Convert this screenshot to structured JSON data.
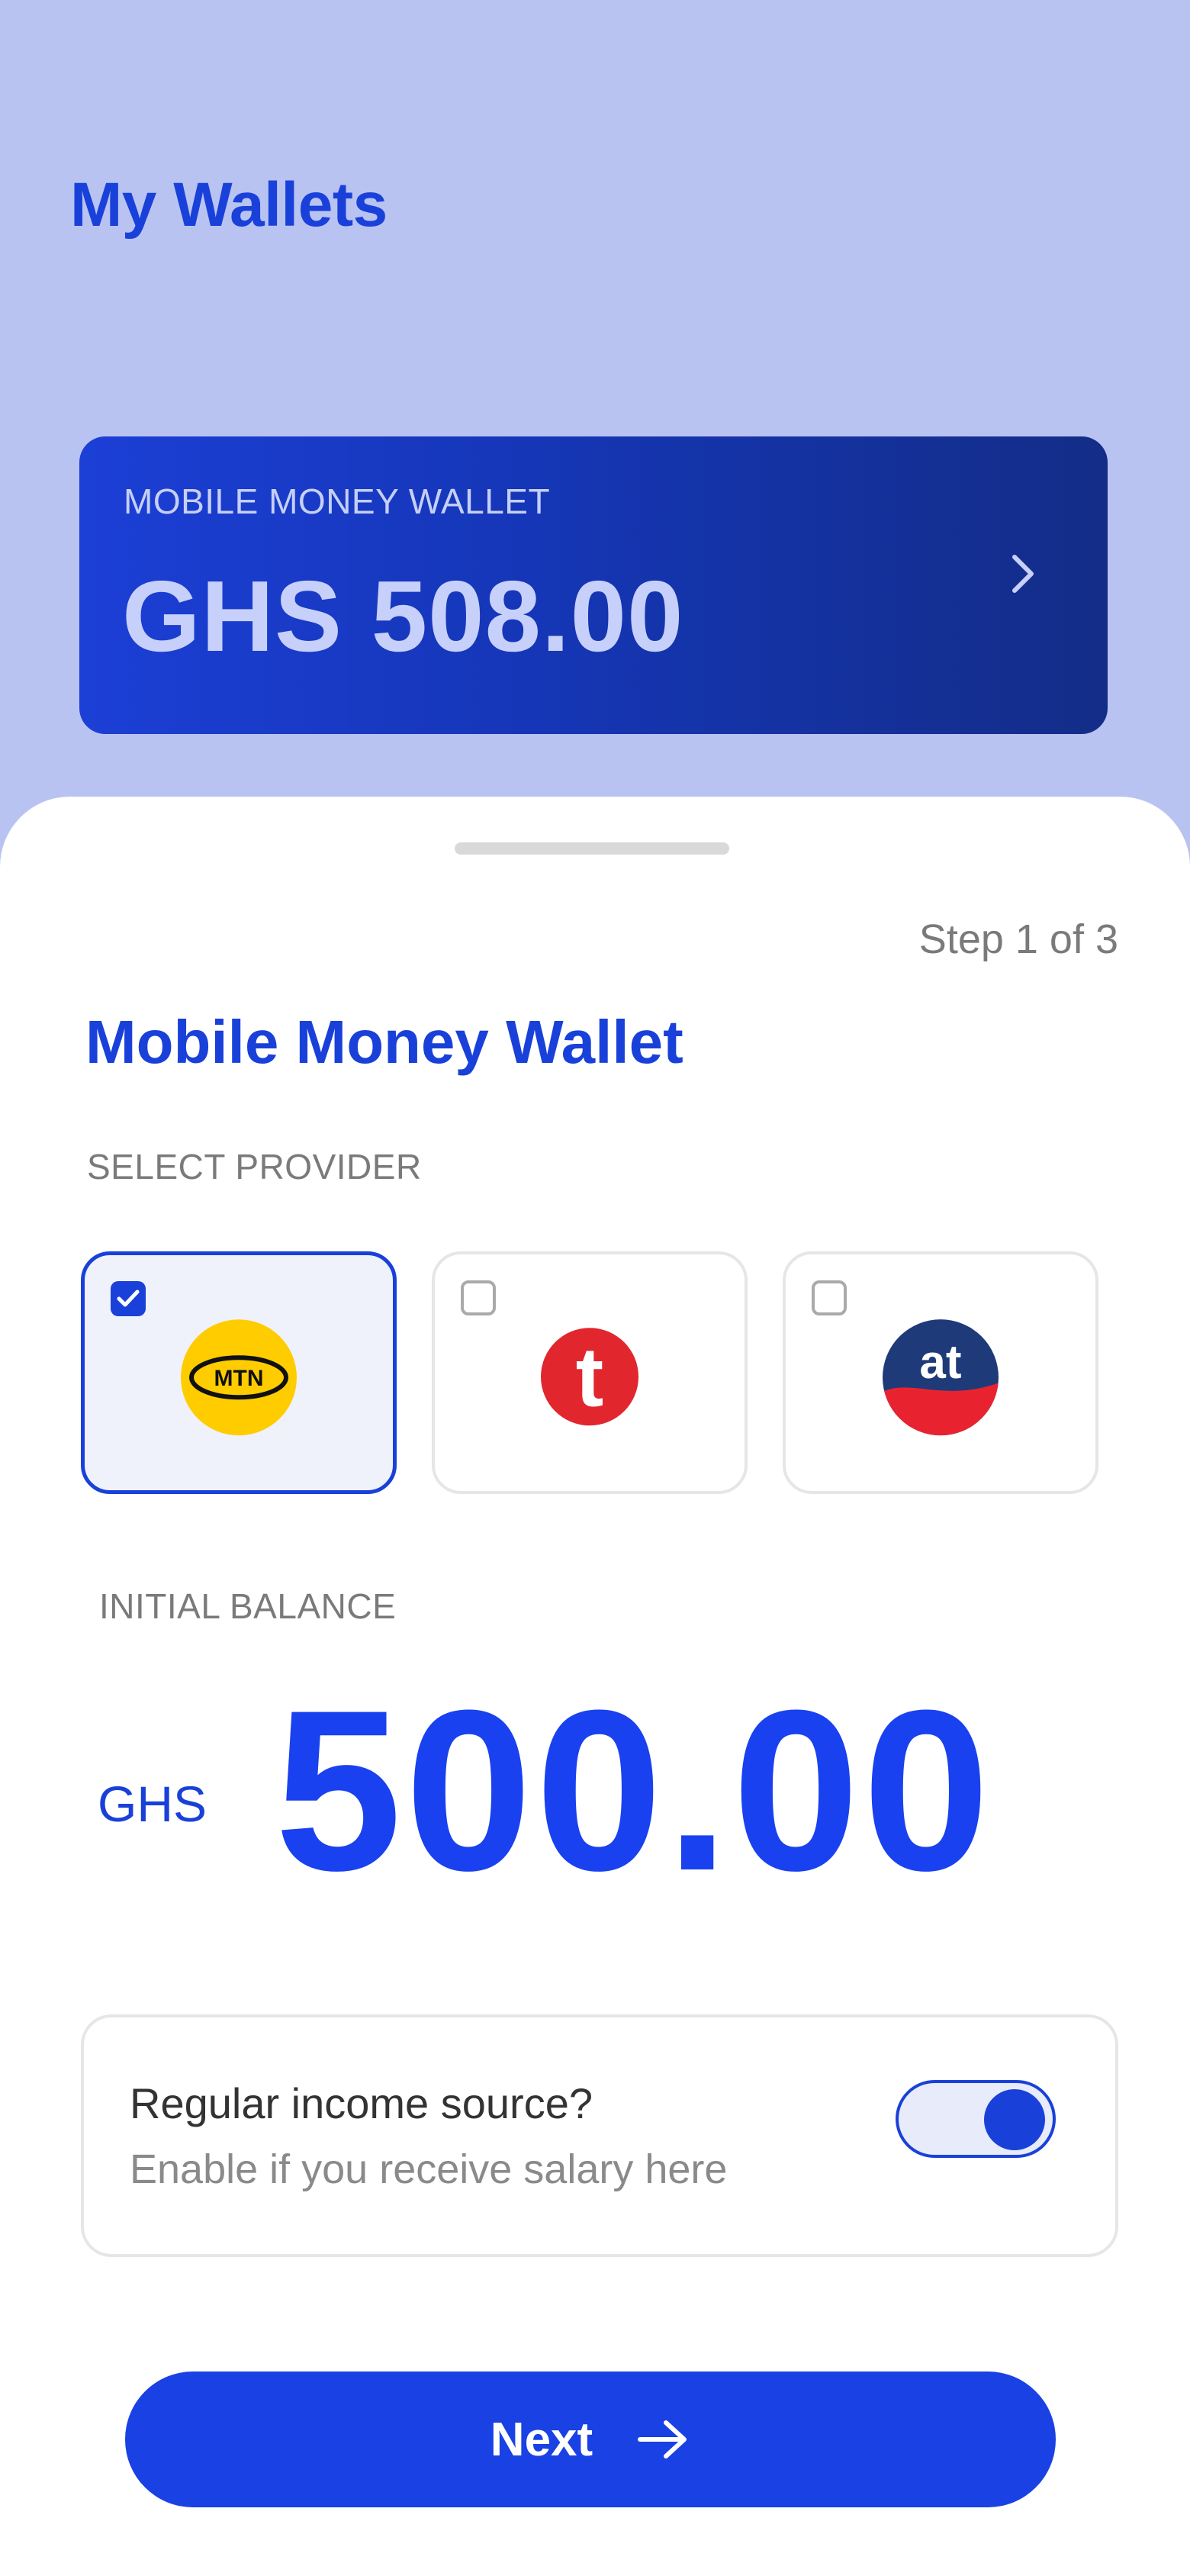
{
  "header": {
    "title": "My Wallets"
  },
  "wallet_card": {
    "label": "MOBILE MONEY WALLET",
    "balance": "GHS 508.00",
    "chevron_icon": "chevron-right-icon"
  },
  "sheet": {
    "step": "Step 1 of 3",
    "title": "Mobile Money Wallet",
    "provider_label": "SELECT PROVIDER",
    "providers": [
      {
        "logo_text": "MTN",
        "selected": true,
        "color": "#ffcc00"
      },
      {
        "logo_text": "t",
        "selected": false,
        "color": "#e1262d"
      },
      {
        "logo_text": "at",
        "selected": false,
        "color": "#1f3a78"
      }
    ],
    "balance_label": "INITIAL BALANCE",
    "currency": "GHS",
    "amount": "500.00",
    "income": {
      "title": "Regular income source?",
      "subtitle": "Enable if you receive salary here",
      "enabled": true
    },
    "next_label": "Next"
  },
  "colors": {
    "accent": "#1941d9",
    "background": "#b9c3f2"
  }
}
